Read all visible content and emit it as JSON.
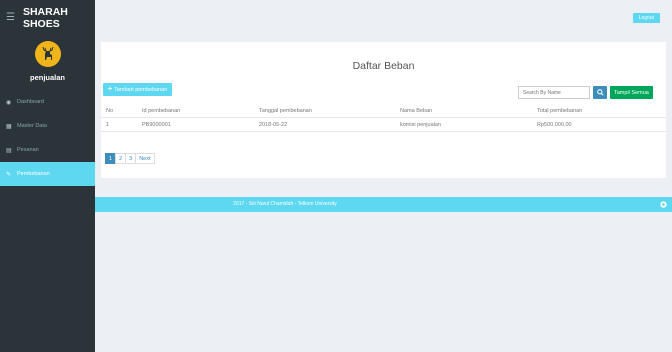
{
  "sidebar": {
    "brand": "SHARAH SHOES",
    "user": "penjualan",
    "items": [
      {
        "label": "Dashboard"
      },
      {
        "label": "Master Data"
      },
      {
        "label": "Pesanan"
      },
      {
        "label": "Pembebanan"
      }
    ]
  },
  "topbar": {
    "logout_label": "Logout"
  },
  "main": {
    "title": "Daftar Beban",
    "add_label": "Tambah pembebanan",
    "search_placeholder": "Search By Name",
    "show_all_label": "Tampil Semua",
    "columns": [
      "No",
      "Id pembebanan",
      "Tanggal pembebanan",
      "Nama Beban",
      "Total pembebanan"
    ],
    "rows": [
      [
        "1",
        "PB9000001",
        "2018-05-22",
        "komisi penjualan",
        "Rp500.000,00"
      ]
    ],
    "pagination": [
      "1",
      "2",
      "3",
      "Next"
    ]
  },
  "footer": {
    "text": "2017 - Siti Nurul Chamidah - Telkom University"
  },
  "colors": {
    "accent": "#5ed8f0",
    "sidebar": "#2b3438",
    "primary": "#3c8dbc",
    "success": "#00a65a",
    "avatar": "#f1b51c"
  }
}
